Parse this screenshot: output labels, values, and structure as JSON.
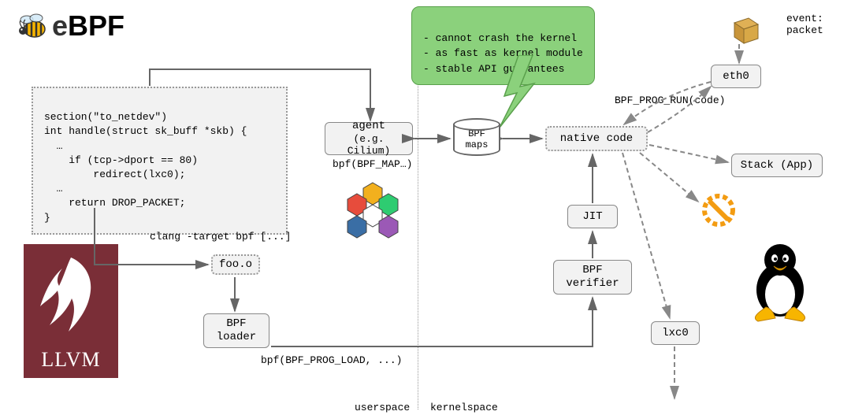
{
  "logo": {
    "text_e": "e",
    "text_rest": "BPF"
  },
  "tooltip": {
    "line1": "- cannot crash the kernel",
    "line2": "- as fast as kernel module",
    "line3": "- stable API guarantees"
  },
  "code": {
    "l1": "section(\"to_netdev\")",
    "l2": "int handle(struct sk_buff *skb) {",
    "l3": "  …",
    "l4": "    if (tcp->dport == 80)",
    "l5": "        redirect(lxc0);",
    "l6": "  …",
    "l7": "    return DROP_PACKET;",
    "l8": "}"
  },
  "boxes": {
    "agent_l1": "agent",
    "agent_l2": "(e.g. Cilium)",
    "bpf_maps": "BPF\nmaps",
    "native_code": "native code",
    "eth0": "eth0",
    "stack_app": "Stack (App)",
    "jit": "JIT",
    "bpf_verifier": "BPF\nverifier",
    "foo_o": "foo.o",
    "bpf_loader": "BPF\nloader",
    "lxc0": "lxc0"
  },
  "labels": {
    "event": "event:\npacket",
    "bpf_prog_run": "BPF_PROG_RUN(code)",
    "bpf_map_call": "bpf(BPF_MAP…)",
    "clang": "clang -target bpf [...]",
    "bpf_prog_load": "bpf(BPF_PROG_LOAD, ...)",
    "userspace": "userspace",
    "kernelspace": "kernelspace",
    "llvm": "LLVM"
  },
  "icons": {
    "bee": "bee-icon",
    "hex": "cilium-hex-icon",
    "tux": "tux-penguin-icon",
    "prohibit": "no-entry-icon",
    "cube": "packet-cube-icon",
    "lightning": "lightning-icon"
  }
}
